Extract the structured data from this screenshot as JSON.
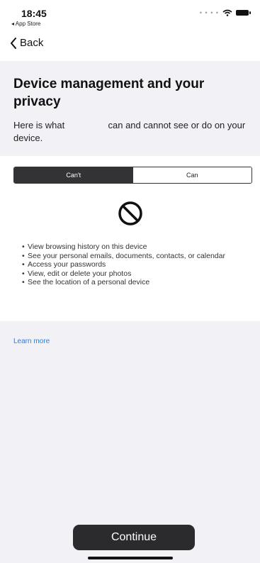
{
  "status_bar": {
    "time": "18:45",
    "back_app": "◂ App Store",
    "signal_dots": "• • • •",
    "wifi_icon": "wifi-icon",
    "battery_icon": "battery-icon"
  },
  "nav": {
    "back_label": "Back",
    "back_icon": "chevron-left-icon"
  },
  "header": {
    "title": "Device management and your privacy",
    "intro_before": "Here is what",
    "intro_after": "can and cannot see or do on your device."
  },
  "segmented": {
    "cant_label": "Can't",
    "can_label": "Can",
    "selected": "Can't"
  },
  "content": {
    "icon": "prohibited-icon",
    "items": [
      "View browsing history on this device",
      "See your personal emails, documents, contacts, or calendar",
      "Access your passwords",
      "View, edit or delete your photos",
      "See the location of a personal device"
    ]
  },
  "footer": {
    "learn_more": "Learn more",
    "continue_label": "Continue"
  },
  "colors": {
    "link": "#2f7dd8",
    "button": "#2b2b2e",
    "background": "#f2f1f6"
  }
}
